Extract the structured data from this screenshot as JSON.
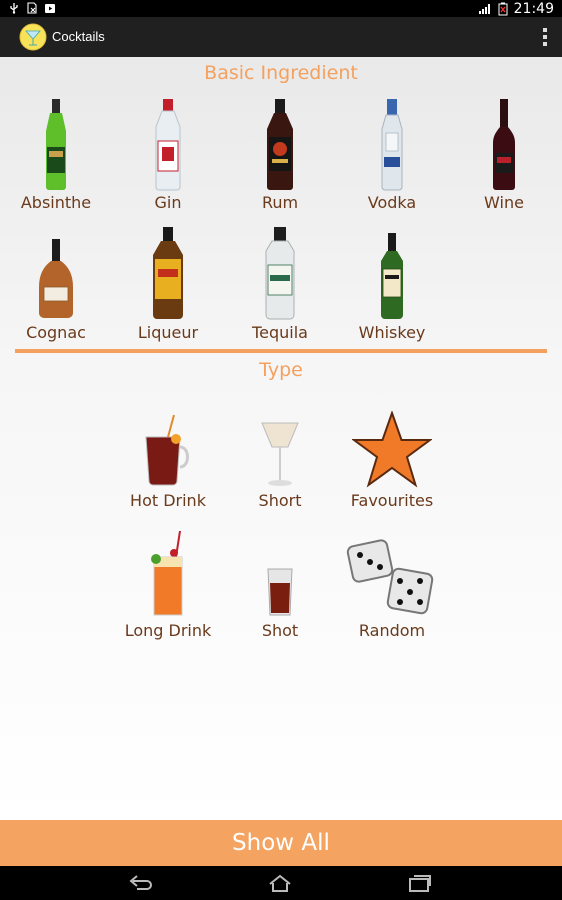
{
  "status_bar": {
    "time": "21:49",
    "icons": [
      "usb-icon",
      "sim-missing-icon",
      "play-store-icon",
      "signal-icon",
      "battery-icon"
    ]
  },
  "action_bar": {
    "app_title": "Cocktails",
    "icons": [
      "cocktail-logo-icon",
      "overflow-menu-icon"
    ]
  },
  "basic_ingredient": {
    "title": "Basic Ingredient",
    "items": [
      {
        "label": "Absinthe",
        "icon": "absinthe-bottle-icon"
      },
      {
        "label": "Gin",
        "icon": "gin-bottle-icon"
      },
      {
        "label": "Rum",
        "icon": "rum-bottle-icon"
      },
      {
        "label": "Vodka",
        "icon": "vodka-bottle-icon"
      },
      {
        "label": "Wine",
        "icon": "wine-bottle-icon"
      },
      {
        "label": "Cognac",
        "icon": "cognac-bottle-icon"
      },
      {
        "label": "Liqueur",
        "icon": "liqueur-bottle-icon"
      },
      {
        "label": "Tequila",
        "icon": "tequila-bottle-icon"
      },
      {
        "label": "Whiskey",
        "icon": "whiskey-bottle-icon"
      }
    ]
  },
  "type": {
    "title": "Type",
    "items": [
      {
        "label": "Hot Drink",
        "icon": "hot-drink-icon"
      },
      {
        "label": "Short",
        "icon": "short-cocktail-icon"
      },
      {
        "label": "Favourites",
        "icon": "star-icon"
      },
      {
        "label": "Long Drink",
        "icon": "long-drink-icon"
      },
      {
        "label": "Shot",
        "icon": "shot-glass-icon"
      },
      {
        "label": "Random",
        "icon": "dice-icon"
      }
    ]
  },
  "footer": {
    "show_all_label": "Show All"
  },
  "nav_bar": {
    "icons": [
      "back-icon",
      "home-icon",
      "recent-apps-icon"
    ]
  },
  "colors": {
    "accent": "#f4a15f",
    "label_text": "#6a3a1c",
    "action_bar_bg": "#202020",
    "show_all_bg": "#f4a460"
  }
}
